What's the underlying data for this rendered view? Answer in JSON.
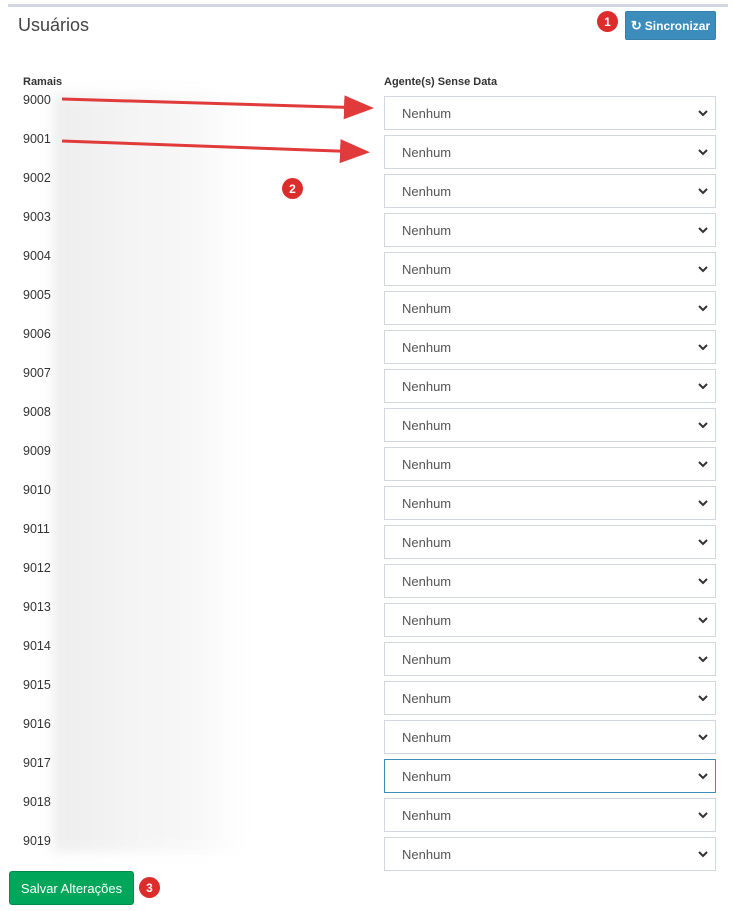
{
  "page": {
    "title": "Usuários"
  },
  "toolbar": {
    "sync_label": "Sincronizar",
    "sync_icon": "refresh-icon"
  },
  "table": {
    "col_extension": "Ramais",
    "col_agent": "Agente(s) Sense Data",
    "rows": [
      {
        "ext": "9000",
        "agent": "Nenhum"
      },
      {
        "ext": "9001",
        "agent": "Nenhum"
      },
      {
        "ext": "9002",
        "agent": "Nenhum"
      },
      {
        "ext": "9003",
        "agent": "Nenhum"
      },
      {
        "ext": "9004",
        "agent": "Nenhum"
      },
      {
        "ext": "9005",
        "agent": "Nenhum"
      },
      {
        "ext": "9006",
        "agent": "Nenhum"
      },
      {
        "ext": "9007",
        "agent": "Nenhum"
      },
      {
        "ext": "9008",
        "agent": "Nenhum"
      },
      {
        "ext": "9009",
        "agent": "Nenhum"
      },
      {
        "ext": "9010",
        "agent": "Nenhum"
      },
      {
        "ext": "9011",
        "agent": "Nenhum"
      },
      {
        "ext": "9012",
        "agent": "Nenhum"
      },
      {
        "ext": "9013",
        "agent": "Nenhum"
      },
      {
        "ext": "9014",
        "agent": "Nenhum"
      },
      {
        "ext": "9015",
        "agent": "Nenhum"
      },
      {
        "ext": "9016",
        "agent": "Nenhum"
      },
      {
        "ext": "9017",
        "agent": "Nenhum"
      },
      {
        "ext": "9018",
        "agent": "Nenhum"
      },
      {
        "ext": "9019",
        "agent": "Nenhum"
      }
    ]
  },
  "footer": {
    "save_label": "Salvar Alterações"
  },
  "annotations": {
    "badge1": "1",
    "badge2": "2",
    "badge3": "3"
  },
  "colors": {
    "primary": "#3c8dbc",
    "success": "#00a65a",
    "badge": "#dd2c2c",
    "arrow": "#e03a3a"
  }
}
